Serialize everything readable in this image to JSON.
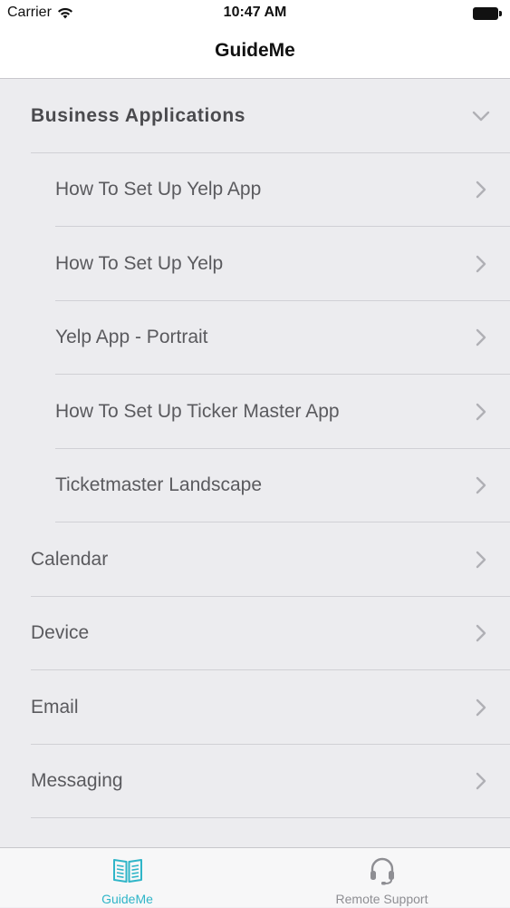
{
  "status_bar": {
    "carrier": "Carrier",
    "time": "10:47 AM"
  },
  "nav": {
    "title": "GuideMe"
  },
  "list": {
    "section_header": "Business Applications",
    "children": [
      {
        "label": "How To Set Up Yelp App"
      },
      {
        "label": "How To Set Up Yelp"
      },
      {
        "label": "Yelp App - Portrait"
      },
      {
        "label": "How To Set Up Ticker Master App"
      },
      {
        "label": "Ticketmaster Landscape"
      }
    ],
    "categories": [
      {
        "label": "Calendar"
      },
      {
        "label": "Device"
      },
      {
        "label": "Email"
      },
      {
        "label": "Messaging"
      }
    ]
  },
  "tabs": [
    {
      "label": "GuideMe",
      "icon": "book-icon",
      "color": "#2fb5c8"
    },
    {
      "label": "Remote Support",
      "icon": "headset-icon",
      "color": "#8e8e93"
    }
  ],
  "colors": {
    "accent": "#2fb5c8",
    "background": "#ececef"
  }
}
